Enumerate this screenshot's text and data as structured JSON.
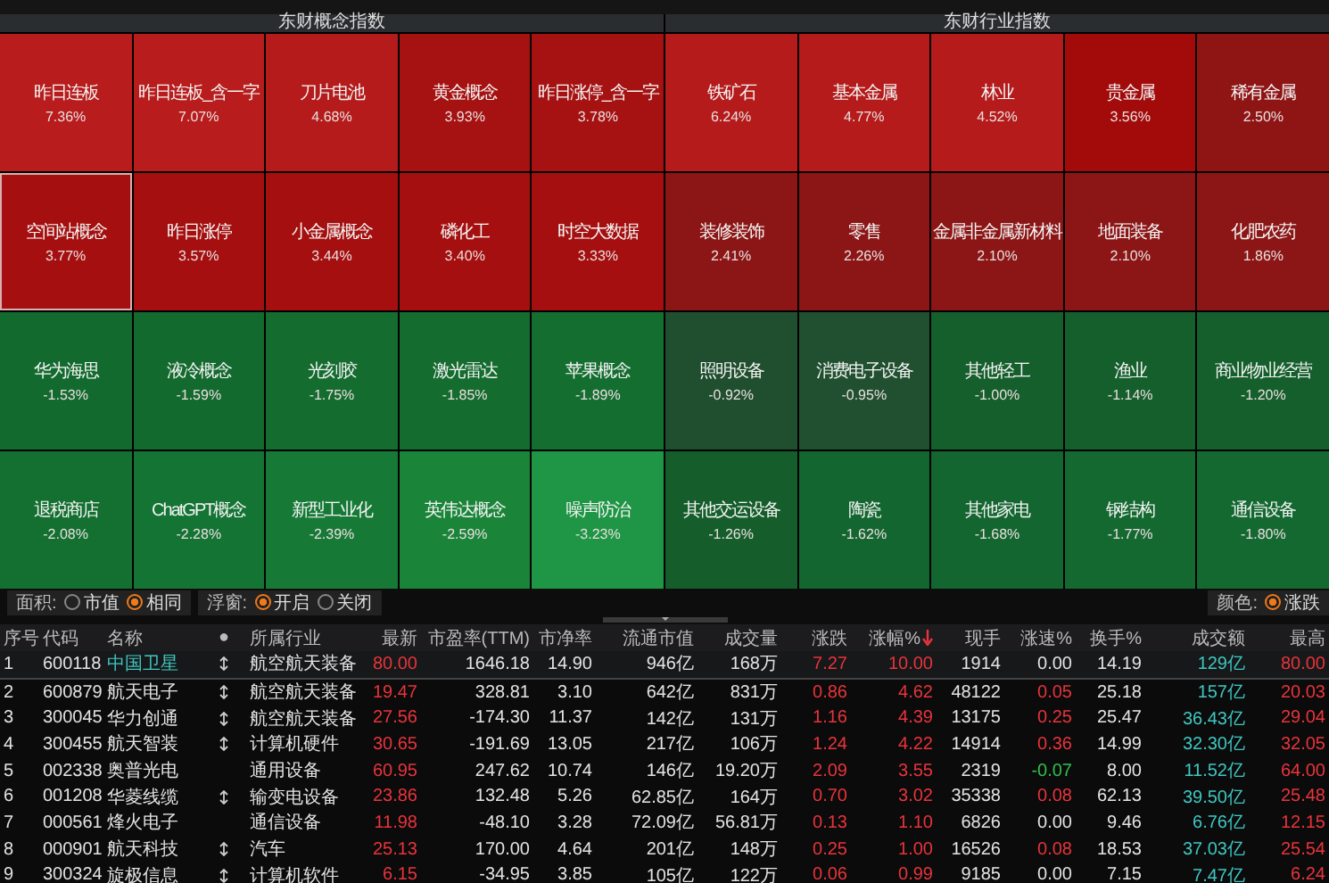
{
  "heatmaps": [
    {
      "title": "东财概念指数",
      "tiles": [
        {
          "name": "昨日连板",
          "change": "7.36%",
          "color": "#b81c1c",
          "selected": false
        },
        {
          "name": "昨日连板_含一字",
          "change": "7.07%",
          "color": "#b81c1c",
          "selected": false
        },
        {
          "name": "刀片电池",
          "change": "4.68%",
          "color": "#b51b1b",
          "selected": false
        },
        {
          "name": "黄金概念",
          "change": "3.93%",
          "color": "#a61212",
          "selected": false
        },
        {
          "name": "昨日涨停_含一字",
          "change": "3.78%",
          "color": "#a61212",
          "selected": false
        },
        {
          "name": "空间站概念",
          "change": "3.77%",
          "color": "#a50f0f",
          "selected": true
        },
        {
          "name": "昨日涨停",
          "change": "3.57%",
          "color": "#a50f0f",
          "selected": false
        },
        {
          "name": "小金属概念",
          "change": "3.44%",
          "color": "#a50f0f",
          "selected": false
        },
        {
          "name": "磷化工",
          "change": "3.40%",
          "color": "#a50f0f",
          "selected": false
        },
        {
          "name": "时空大数据",
          "change": "3.33%",
          "color": "#a50f0f",
          "selected": false
        },
        {
          "name": "华为海思",
          "change": "-1.53%",
          "color": "#136a2e",
          "selected": false
        },
        {
          "name": "液冷概念",
          "change": "-1.59%",
          "color": "#136a2e",
          "selected": false
        },
        {
          "name": "光刻胶",
          "change": "-1.75%",
          "color": "#146c2f",
          "selected": false
        },
        {
          "name": "激光雷达",
          "change": "-1.85%",
          "color": "#146c2f",
          "selected": false
        },
        {
          "name": "苹果概念",
          "change": "-1.89%",
          "color": "#146e30",
          "selected": false
        },
        {
          "name": "退税商店",
          "change": "-2.08%",
          "color": "#137030",
          "selected": false
        },
        {
          "name": "ChatGPT概念",
          "change": "-2.28%",
          "color": "#137433",
          "selected": false
        },
        {
          "name": "新型工业化",
          "change": "-2.39%",
          "color": "#167a36",
          "selected": false
        },
        {
          "name": "英伟达概念",
          "change": "-2.59%",
          "color": "#1a8539",
          "selected": false
        },
        {
          "name": "噪声防治",
          "change": "-3.23%",
          "color": "#1e9645",
          "selected": false
        }
      ]
    },
    {
      "title": "东财行业指数",
      "tiles": [
        {
          "name": "铁矿石",
          "change": "6.24%",
          "color": "#b51b1b",
          "selected": false
        },
        {
          "name": "基本金属",
          "change": "4.77%",
          "color": "#b51b1b",
          "selected": false
        },
        {
          "name": "林业",
          "change": "4.52%",
          "color": "#b51b1b",
          "selected": false
        },
        {
          "name": "贵金属",
          "change": "3.56%",
          "color": "#a30b0b",
          "selected": false
        },
        {
          "name": "稀有金属",
          "change": "2.50%",
          "color": "#8f1515",
          "selected": false
        },
        {
          "name": "装修装饰",
          "change": "2.41%",
          "color": "#8c1616",
          "selected": false
        },
        {
          "name": "零售",
          "change": "2.26%",
          "color": "#8c1616",
          "selected": false
        },
        {
          "name": "金属非金属新材料",
          "change": "2.10%",
          "color": "#8c1616",
          "selected": false
        },
        {
          "name": "地面装备",
          "change": "2.10%",
          "color": "#8c1616",
          "selected": false
        },
        {
          "name": "化肥农药",
          "change": "1.86%",
          "color": "#8c1616",
          "selected": false
        },
        {
          "name": "照明设备",
          "change": "-0.92%",
          "color": "#1f4f2e",
          "selected": false
        },
        {
          "name": "消费电子设备",
          "change": "-0.95%",
          "color": "#20502f",
          "selected": false
        },
        {
          "name": "其他轻工",
          "change": "-1.00%",
          "color": "#155f2c",
          "selected": false
        },
        {
          "name": "渔业",
          "change": "-1.14%",
          "color": "#155f2c",
          "selected": false
        },
        {
          "name": "商业物业经营",
          "change": "-1.20%",
          "color": "#155f2c",
          "selected": false
        },
        {
          "name": "其他交运设备",
          "change": "-1.26%",
          "color": "#155e2b",
          "selected": false
        },
        {
          "name": "陶瓷",
          "change": "-1.62%",
          "color": "#146630",
          "selected": false
        },
        {
          "name": "其他家电",
          "change": "-1.68%",
          "color": "#146630",
          "selected": false
        },
        {
          "name": "钢结构",
          "change": "-1.77%",
          "color": "#146931",
          "selected": false
        },
        {
          "name": "通信设备",
          "change": "-1.80%",
          "color": "#146931",
          "selected": false
        }
      ]
    }
  ],
  "toolbar": {
    "area_label": "面积:",
    "area_options": [
      {
        "label": "市值",
        "selected": false
      },
      {
        "label": "相同",
        "selected": true
      }
    ],
    "float_label": "浮窗:",
    "float_options": [
      {
        "label": "开启",
        "selected": true
      },
      {
        "label": "关闭",
        "selected": false
      }
    ],
    "color_label": "颜色:",
    "color_option": {
      "label": "涨跌",
      "selected": true
    }
  },
  "table": {
    "columns": [
      {
        "label": "序号",
        "kind": "text"
      },
      {
        "label": "代码",
        "kind": "text"
      },
      {
        "label": "名称",
        "kind": "name"
      },
      {
        "label": "●",
        "kind": "flag"
      },
      {
        "label": "所属行业",
        "kind": "text"
      },
      {
        "label": "最新",
        "kind": "price"
      },
      {
        "label": "市盈率(TTM)",
        "kind": "number"
      },
      {
        "label": "市净率",
        "kind": "number"
      },
      {
        "label": "流通市值",
        "kind": "number"
      },
      {
        "label": "成交量",
        "kind": "number"
      },
      {
        "label": "涨跌",
        "kind": "price"
      },
      {
        "label": "涨幅%",
        "kind": "price",
        "sorted_desc": true
      },
      {
        "label": "现手",
        "kind": "number"
      },
      {
        "label": "涨速%",
        "kind": "speed"
      },
      {
        "label": "换手%",
        "kind": "number"
      },
      {
        "label": "成交额",
        "kind": "amount"
      },
      {
        "label": "最高",
        "kind": "price"
      }
    ],
    "rows": [
      {
        "selected": true,
        "marked": true,
        "speed_up": false,
        "speed_down": false,
        "cells": [
          "1",
          "600118",
          "中国卫星",
          "",
          "航空航天装备",
          "80.00",
          "1646.18",
          "14.90",
          "946亿",
          "168万",
          "7.27",
          "10.00",
          "1914",
          "0.00",
          "14.19",
          "129亿",
          "80.00"
        ]
      },
      {
        "selected": false,
        "marked": true,
        "speed_up": true,
        "speed_down": false,
        "cells": [
          "2",
          "600879",
          "航天电子",
          "",
          "航空航天装备",
          "19.47",
          "328.81",
          "3.10",
          "642亿",
          "831万",
          "0.86",
          "4.62",
          "48122",
          "0.05",
          "25.18",
          "157亿",
          "20.03"
        ]
      },
      {
        "selected": false,
        "marked": true,
        "speed_up": true,
        "speed_down": false,
        "cells": [
          "3",
          "300045",
          "华力创通",
          "",
          "航空航天装备",
          "27.56",
          "-174.30",
          "11.37",
          "142亿",
          "131万",
          "1.16",
          "4.39",
          "13175",
          "0.25",
          "25.47",
          "36.43亿",
          "29.04"
        ]
      },
      {
        "selected": false,
        "marked": true,
        "speed_up": true,
        "speed_down": false,
        "cells": [
          "4",
          "300455",
          "航天智装",
          "",
          "计算机硬件",
          "30.65",
          "-191.69",
          "13.05",
          "217亿",
          "106万",
          "1.24",
          "4.22",
          "14914",
          "0.36",
          "14.99",
          "32.30亿",
          "32.05"
        ]
      },
      {
        "selected": false,
        "marked": false,
        "speed_up": false,
        "speed_down": true,
        "cells": [
          "5",
          "002338",
          "奥普光电",
          "",
          "通用设备",
          "60.95",
          "247.62",
          "10.74",
          "146亿",
          "19.20万",
          "2.09",
          "3.55",
          "2319",
          "-0.07",
          "8.00",
          "11.52亿",
          "64.00"
        ]
      },
      {
        "selected": false,
        "marked": true,
        "speed_up": true,
        "speed_down": false,
        "cells": [
          "6",
          "001208",
          "华菱线缆",
          "",
          "输变电设备",
          "23.86",
          "132.48",
          "5.26",
          "62.85亿",
          "164万",
          "0.70",
          "3.02",
          "35338",
          "0.08",
          "62.13",
          "39.50亿",
          "25.48"
        ]
      },
      {
        "selected": false,
        "marked": false,
        "speed_up": false,
        "speed_down": false,
        "cells": [
          "7",
          "000561",
          "烽火电子",
          "",
          "通信设备",
          "11.98",
          "-48.10",
          "3.28",
          "72.09亿",
          "56.81万",
          "0.13",
          "1.10",
          "6826",
          "0.00",
          "9.46",
          "6.76亿",
          "12.15"
        ]
      },
      {
        "selected": false,
        "marked": true,
        "speed_up": true,
        "speed_down": false,
        "cells": [
          "8",
          "000901",
          "航天科技",
          "",
          "汽车",
          "25.13",
          "170.00",
          "4.64",
          "201亿",
          "148万",
          "0.25",
          "1.00",
          "16526",
          "0.08",
          "18.53",
          "37.03亿",
          "25.54"
        ]
      },
      {
        "selected": false,
        "marked": true,
        "speed_up": false,
        "speed_down": false,
        "cells": [
          "9",
          "300324",
          "旋极信息",
          "",
          "计算机软件",
          "6.15",
          "-34.95",
          "3.85",
          "105亿",
          "122万",
          "0.06",
          "0.99",
          "9185",
          "0.00",
          "7.15",
          "7.47亿",
          "6.24"
        ]
      }
    ]
  }
}
